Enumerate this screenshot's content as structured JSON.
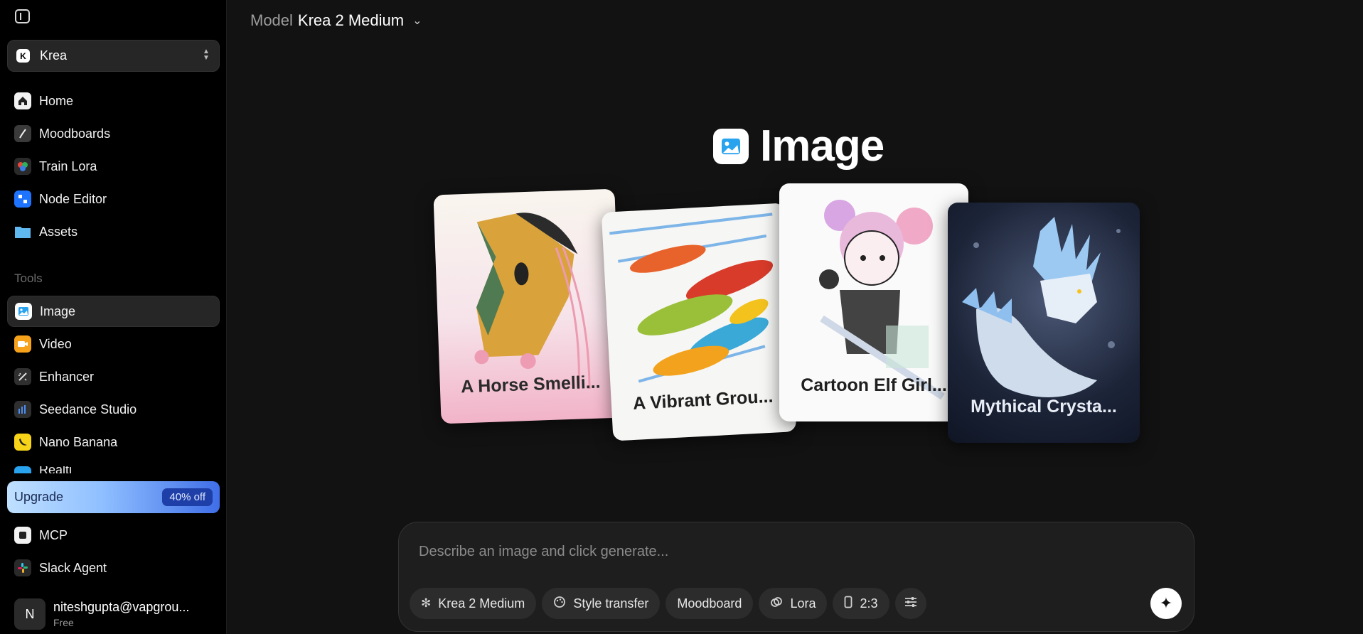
{
  "sidebar": {
    "workspace": {
      "label": "Krea",
      "logo_glyph": "K"
    },
    "nav_items": [
      {
        "label": "Home",
        "icon": "home-icon"
      },
      {
        "label": "Moodboards",
        "icon": "moodboards-icon"
      },
      {
        "label": "Train Lora",
        "icon": "train-lora-icon"
      },
      {
        "label": "Node Editor",
        "icon": "node-editor-icon"
      },
      {
        "label": "Assets",
        "icon": "folder-icon"
      }
    ],
    "tools_label": "Tools",
    "tool_items": [
      {
        "label": "Image",
        "icon": "image-icon",
        "active": true
      },
      {
        "label": "Video",
        "icon": "video-icon"
      },
      {
        "label": "Enhancer",
        "icon": "enhancer-icon"
      },
      {
        "label": "Seedance Studio",
        "icon": "seedance-icon"
      },
      {
        "label": "Nano Banana",
        "icon": "banana-icon"
      },
      {
        "label": "Realti",
        "icon": "realtime-icon"
      }
    ],
    "upgrade": {
      "label": "Upgrade",
      "badge": "40% off"
    },
    "bottom_items": [
      {
        "label": "MCP",
        "icon": "mcp-icon"
      },
      {
        "label": "Slack Agent",
        "icon": "slack-icon"
      }
    ],
    "user": {
      "initial": "N",
      "name": "niteshgupta@vapgrou...",
      "plan": "Free"
    }
  },
  "header": {
    "model_prefix": "Model",
    "model_name": "Krea 2 Medium"
  },
  "hero": {
    "title": "Image"
  },
  "cards": [
    {
      "title": "A Horse Smelli..."
    },
    {
      "title": "A Vibrant Grou..."
    },
    {
      "title": "Cartoon Elf Girl..."
    },
    {
      "title": "Mythical Crysta..."
    }
  ],
  "prompt": {
    "placeholder": "Describe an image and click generate...",
    "chips": [
      {
        "label": "Krea 2 Medium",
        "icon": "krea-logo-icon"
      },
      {
        "label": "Style transfer",
        "icon": "palette-icon"
      },
      {
        "label": "Moodboard",
        "icon": ""
      },
      {
        "label": "Lora",
        "icon": "lora-icon"
      },
      {
        "label": "2:3",
        "icon": "aspect-ratio-icon"
      },
      {
        "label": "",
        "icon": "sliders-icon"
      }
    ]
  },
  "colors": {
    "background": "#121212",
    "sidebar": "#000000",
    "accent": "#1f3fa8"
  }
}
